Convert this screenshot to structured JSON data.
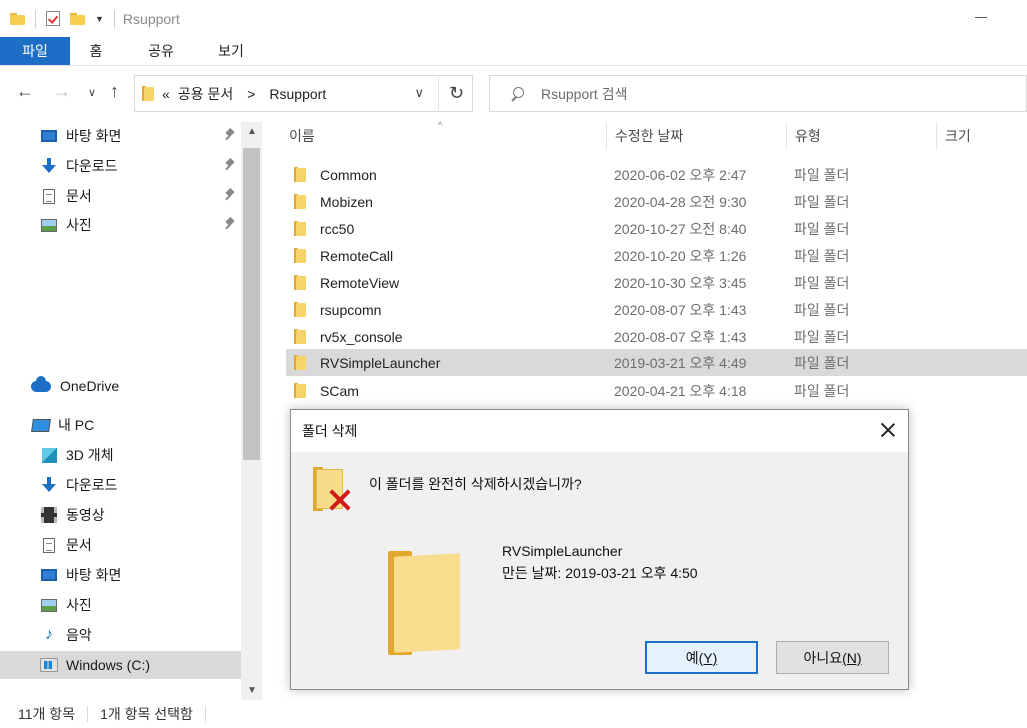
{
  "window": {
    "title": "Rsupport"
  },
  "ribbon": {
    "tabs": [
      "파일",
      "홈",
      "공유",
      "보기"
    ]
  },
  "address": {
    "path_prefix": "«",
    "crumb1": "공용 문서",
    "arrow": ">",
    "crumb2": "Rsupport",
    "search_placeholder": "Rsupport 검색"
  },
  "sidebar": {
    "quick": [
      {
        "label": "바탕 화면",
        "icon": "desktop-icon"
      },
      {
        "label": "다운로드",
        "icon": "download-icon"
      },
      {
        "label": "문서",
        "icon": "document-icon"
      },
      {
        "label": "사진",
        "icon": "pictures-icon"
      }
    ],
    "onedrive": "OneDrive",
    "thispc": "내 PC",
    "pc_items": [
      {
        "label": "3D 개체",
        "icon": "3d-objects-icon"
      },
      {
        "label": "다운로드",
        "icon": "download-icon"
      },
      {
        "label": "동영상",
        "icon": "video-icon"
      },
      {
        "label": "문서",
        "icon": "document-icon"
      },
      {
        "label": "바탕 화면",
        "icon": "desktop-icon"
      },
      {
        "label": "사진",
        "icon": "pictures-icon"
      },
      {
        "label": "음악",
        "icon": "music-icon"
      },
      {
        "label": "Windows (C:)",
        "icon": "drive-icon"
      }
    ]
  },
  "columns": {
    "name": "이름",
    "modified": "수정한 날짜",
    "type": "유형",
    "size": "크기"
  },
  "files": [
    {
      "name": "Common",
      "date": "2020-06-02 오후 2:47",
      "type": "파일 폴더"
    },
    {
      "name": "Mobizen",
      "date": "2020-04-28 오전 9:30",
      "type": "파일 폴더"
    },
    {
      "name": "rcc50",
      "date": "2020-10-27 오전 8:40",
      "type": "파일 폴더"
    },
    {
      "name": "RemoteCall",
      "date": "2020-10-20 오후 1:26",
      "type": "파일 폴더"
    },
    {
      "name": "RemoteView",
      "date": "2020-10-30 오후 3:45",
      "type": "파일 폴더"
    },
    {
      "name": "rsupcomn",
      "date": "2020-08-07 오후 1:43",
      "type": "파일 폴더"
    },
    {
      "name": "rv5x_console",
      "date": "2020-08-07 오후 1:43",
      "type": "파일 폴더"
    },
    {
      "name": "RVSimpleLauncher",
      "date": "2019-03-21 오후 4:49",
      "type": "파일 폴더"
    },
    {
      "name": "SCam",
      "date": "2020-04-21 오후 4:18",
      "type": "파일 폴더"
    }
  ],
  "status": {
    "count": "11개 항목",
    "selected": "1개 항목 선택함"
  },
  "dialog": {
    "title": "폴더 삭제",
    "question": "이 폴더를 완전히 삭제하시겠습니까?",
    "folder_name": "RVSimpleLauncher",
    "created": "만든 날짜: 2019-03-21 오후 4:50",
    "yes": "예",
    "yes_key": "(Y)",
    "no": "아니요",
    "no_key": "(N)"
  },
  "colors": {
    "accent": "#1c6fc4",
    "selection": "#d9d9d9",
    "folder": "#f5cd4f"
  }
}
